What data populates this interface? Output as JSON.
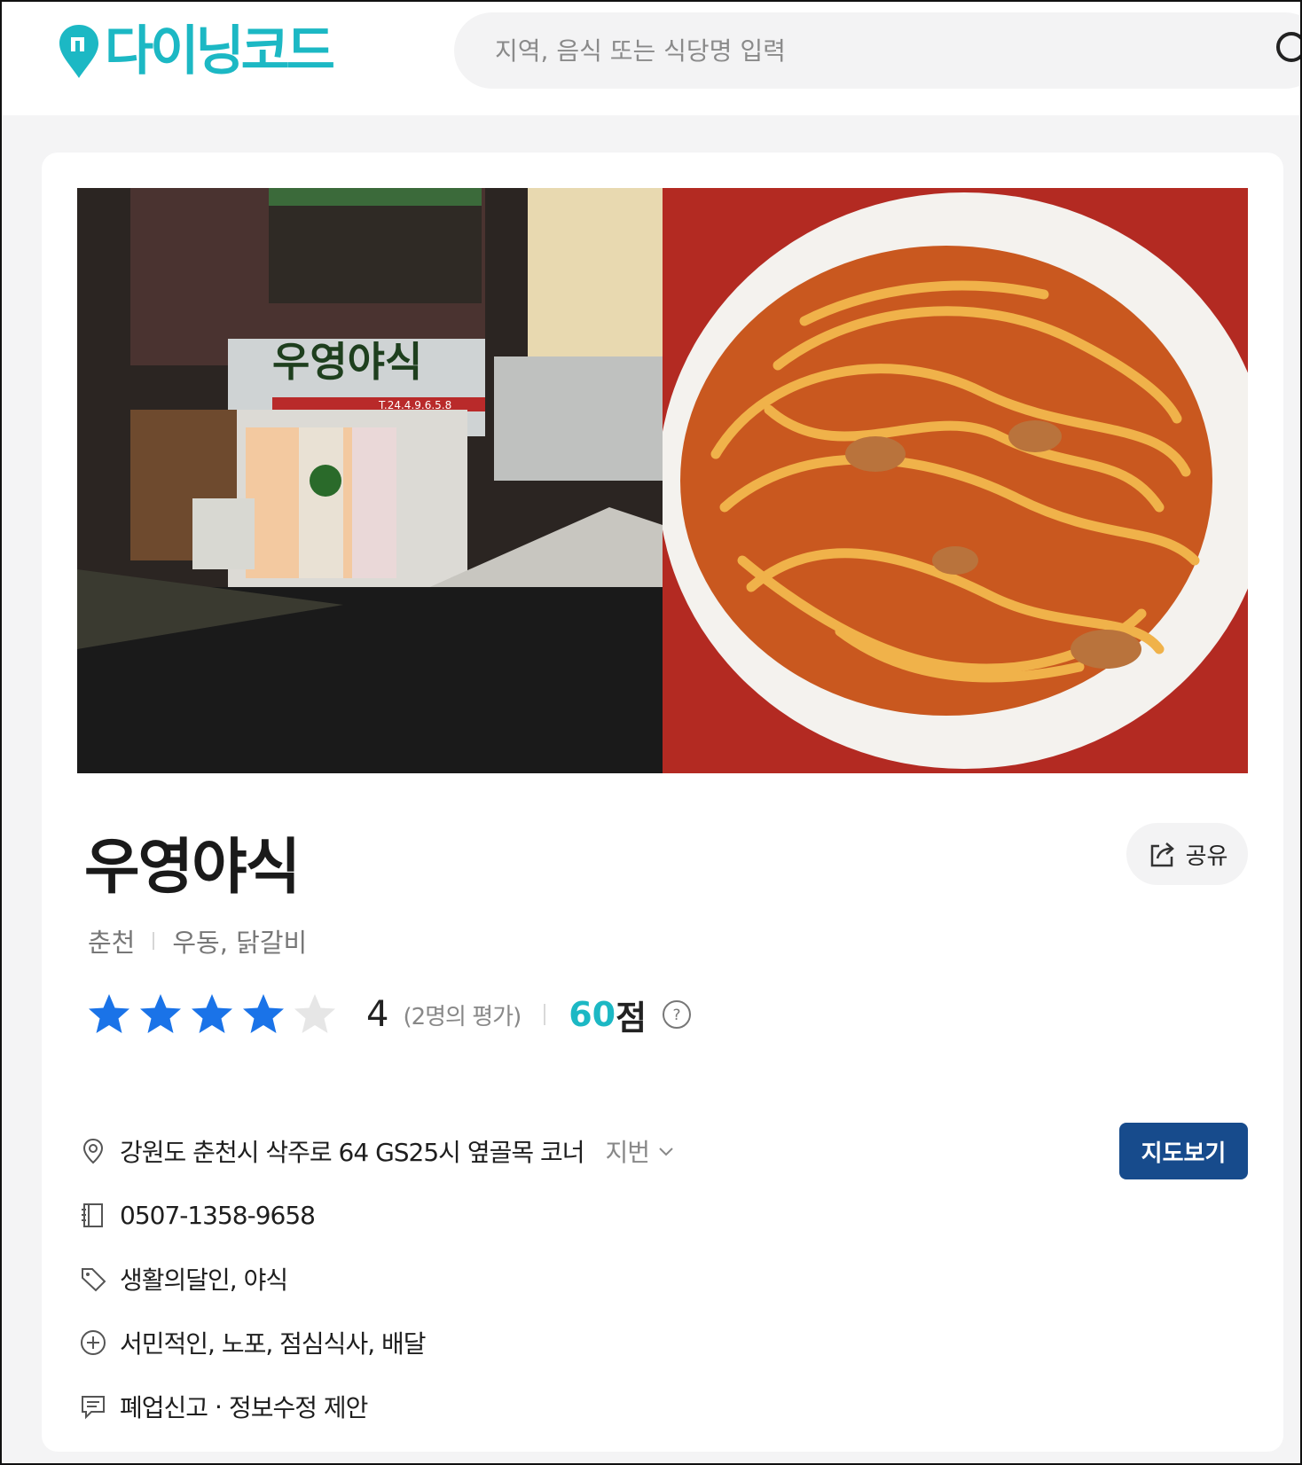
{
  "brand": {
    "logo_text": "다이닝코드",
    "accent_color": "#1cb8c4"
  },
  "search": {
    "placeholder": "지역, 음식 또는 식당명 입력"
  },
  "restaurant": {
    "name": "우영야식",
    "region": "춘천",
    "categories": "우동, 닭갈비",
    "share_label": "공유",
    "rating": {
      "stars_filled": 4,
      "stars_total": 5,
      "value": "4",
      "count_text": "(2명의 평가)",
      "score": "60",
      "score_unit": "점"
    },
    "address": "강원도 춘천시 삭주로 64 GS25시 옆골목 코너",
    "jibun_label": "지번",
    "map_button": "지도보기",
    "phone": "0507-1358-9658",
    "tags": "생활의달인, 야식",
    "features": "서민적인, 노포, 점심식사, 배달",
    "suggest": {
      "close_report": "폐업신고",
      "separator": "·",
      "edit_suggest": "정보수정 제안"
    }
  },
  "photos": [
    {
      "name": "store-front",
      "sign_text": "우영야식",
      "phone_on_sign": "T.24.4.9.6.5.8"
    },
    {
      "name": "dish"
    }
  ],
  "colors": {
    "star_filled": "#1a73e8",
    "star_empty": "#e6e6e6",
    "map_button": "#174b8c"
  }
}
